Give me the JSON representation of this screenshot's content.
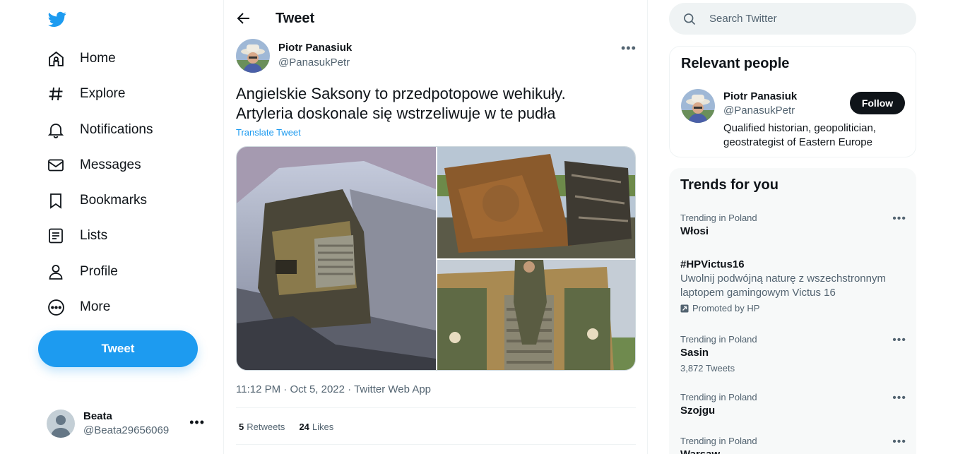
{
  "nav": {
    "items": [
      {
        "label": "Home",
        "icon": "home-icon"
      },
      {
        "label": "Explore",
        "icon": "hashtag-icon"
      },
      {
        "label": "Notifications",
        "icon": "bell-icon"
      },
      {
        "label": "Messages",
        "icon": "envelope-icon"
      },
      {
        "label": "Bookmarks",
        "icon": "bookmark-icon"
      },
      {
        "label": "Lists",
        "icon": "list-icon"
      },
      {
        "label": "Profile",
        "icon": "person-icon"
      },
      {
        "label": "More",
        "icon": "more-circle-icon"
      }
    ],
    "tweet_button": "Tweet",
    "account": {
      "name": "Beata",
      "handle": "@Beata29656069"
    }
  },
  "header": {
    "title": "Tweet"
  },
  "tweet": {
    "author_name": "Piotr Panasiuk",
    "author_handle": "@PanasukPetr",
    "text_line1": "Angielskie Saksony to przedpotopowe wehikuły.",
    "text_line2": "Artyleria doskonale się wstrzeliwuje w te pudła",
    "translate": "Translate Tweet",
    "time": "11:12 PM",
    "date": "Oct 5, 2022",
    "source": "Twitter Web App",
    "separator": "·",
    "retweets": "5",
    "retweets_label": "Retweets",
    "likes": "24",
    "likes_label": "Likes"
  },
  "search": {
    "placeholder": "Search Twitter"
  },
  "relevant_people": {
    "title": "Relevant people",
    "name": "Piotr Panasiuk",
    "handle": "@PanasukPetr",
    "bio_line1": "Qualified historian, geopolitician,",
    "bio_line2": "geostrategist of Eastern Europe",
    "follow": "Follow"
  },
  "trends": {
    "title": "Trends for you",
    "items": [
      {
        "context": "Trending in Poland",
        "topic": "Włosi"
      },
      {
        "topic": "#HPVictus16",
        "desc_line1": "Uwolnij podwójną naturę z wszechstronnym",
        "desc_line2": "laptopem gamingowym Victus 16",
        "promoted": "Promoted by HP"
      },
      {
        "context": "Trending in Poland",
        "topic": "Sasin",
        "count": "3,872 Tweets"
      },
      {
        "context": "Trending in Poland",
        "topic": "Szojgu"
      },
      {
        "context": "Trending in Poland",
        "topic": "Warsaw"
      }
    ]
  },
  "colors": {
    "accent": "#1d9bf0",
    "text": "#0f1419",
    "secondary": "#536471"
  }
}
